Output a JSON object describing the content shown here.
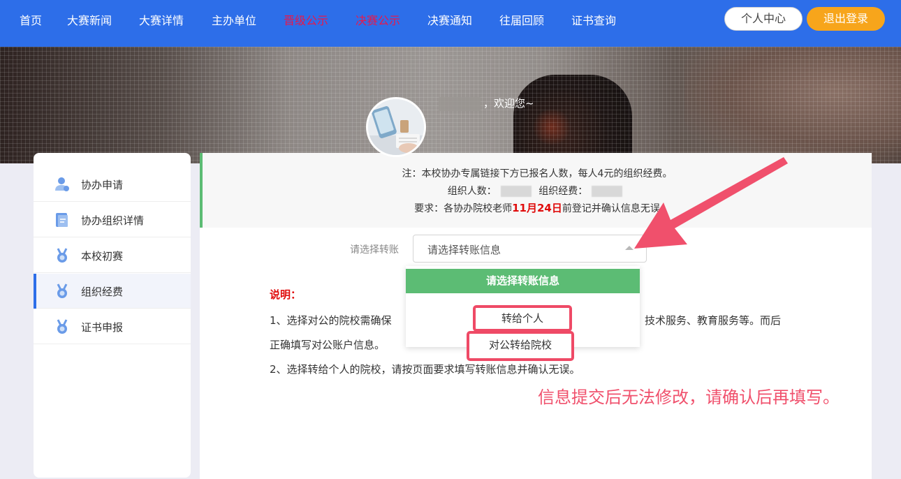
{
  "nav": {
    "items": [
      {
        "label": "首页"
      },
      {
        "label": "大赛新闻"
      },
      {
        "label": "大赛详情"
      },
      {
        "label": "主办单位"
      },
      {
        "label": "晋级公示"
      },
      {
        "label": "决赛公示"
      },
      {
        "label": "决赛通知"
      },
      {
        "label": "往届回顾"
      },
      {
        "label": "证书查询"
      }
    ],
    "personal_center": "个人中心",
    "logout": "退出登录"
  },
  "banner": {
    "welcome": "，欢迎您~"
  },
  "sidebar": {
    "items": [
      {
        "label": "协办申请",
        "icon": "user-icon"
      },
      {
        "label": "协办组织详情",
        "icon": "document-icon"
      },
      {
        "label": "本校初赛",
        "icon": "medal-icon"
      },
      {
        "label": "组织经费",
        "icon": "medal-icon"
      },
      {
        "label": "证书申报",
        "icon": "medal-icon"
      }
    ]
  },
  "notice": {
    "line1": "注：本校协办专属链接下方已报名人数，每人4元的组织经费。",
    "count_label": "组织人数：",
    "fee_label": "组织经费：",
    "req_prefix": "要求：各协办院校老师",
    "req_date": "11月24日",
    "req_suffix": "前登记并确认信息无误"
  },
  "form": {
    "label": "请选择转账",
    "placeholder": "请选择转账信息",
    "dropdown_header": "请选择转账信息",
    "options": [
      "转给个人",
      "对公转给院校"
    ]
  },
  "explain": {
    "title": "说明：",
    "line1_start": "1、选择对公的院校需确保",
    "line1_end": "技术服务、教育服务等。而后",
    "line1_cont": "正确填写对公账户信息。",
    "line2": "2、选择转给个人的院校，请按页面要求填写转账信息并确认无误。"
  },
  "warning": "信息提交后无法修改，请确认后再填写。",
  "colors": {
    "nav_bg": "#2d6ee9",
    "logout_bg": "#f7a51b",
    "highlight_red": "#e00c0c",
    "green": "#5cbc74",
    "annotation_pink": "#ef4a66"
  }
}
